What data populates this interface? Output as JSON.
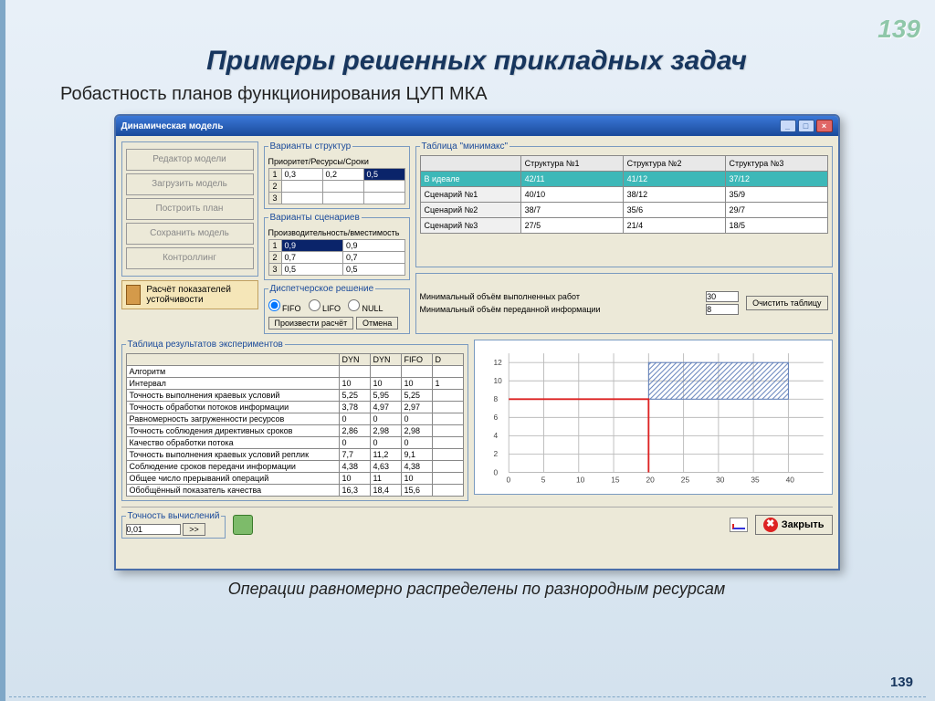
{
  "slide": {
    "title": "Примеры решенных прикладных задач",
    "subtitle": "Робастность планов функционирования ЦУП МКА",
    "bottom_caption": "Операции равномерно распределены по разнородным ресурсам",
    "page_number": "139",
    "corner_number": "139"
  },
  "window": {
    "title": "Динамическая модель",
    "side_buttons": [
      "Редактор модели",
      "Загрузить модель",
      "Построить план",
      "Сохранить модель",
      "Контроллинг"
    ],
    "calc_button": "Расчёт показателей устойчивости"
  },
  "variants_struct": {
    "legend": "Варианты структур",
    "header": "Приоритет/Ресурсы/Сроки",
    "rows": [
      {
        "n": "1",
        "a": "0,3",
        "b": "0,2",
        "c": "0,5",
        "sel": "c"
      },
      {
        "n": "2",
        "a": "",
        "b": "",
        "c": ""
      },
      {
        "n": "3",
        "a": "",
        "b": "",
        "c": ""
      }
    ]
  },
  "variants_scen": {
    "legend": "Варианты сценариев",
    "header": "Производительность/вместимость",
    "rows": [
      {
        "n": "1",
        "a": "0,9",
        "b": "0,9",
        "sel": "a"
      },
      {
        "n": "2",
        "a": "0,7",
        "b": "0,7"
      },
      {
        "n": "3",
        "a": "0,5",
        "b": "0,5"
      }
    ]
  },
  "dispatch": {
    "legend": "Диспетчерское решение",
    "options": [
      "FIFO",
      "LIFO",
      "NULL"
    ],
    "selected": "FIFO",
    "run": "Произвести расчёт",
    "cancel": "Отмена"
  },
  "minimax": {
    "legend": "Таблица \"минимакс\"",
    "cols": [
      "",
      "Структура №1",
      "Структура №2",
      "Структура №3"
    ],
    "rows": [
      {
        "name": "В идеале",
        "vals": [
          "42/11",
          "41/12",
          "37/12"
        ],
        "ideal": true
      },
      {
        "name": "Сценарий №1",
        "vals": [
          "40/10",
          "38/12",
          "35/9"
        ]
      },
      {
        "name": "Сценарий №2",
        "vals": [
          "38/7",
          "35/6",
          "29/7"
        ]
      },
      {
        "name": "Сценарий №3",
        "vals": [
          "27/5",
          "21/4",
          "18/5"
        ]
      }
    ]
  },
  "params": {
    "lbl1": "Минимальный объём выполненных работ",
    "val1": "30",
    "lbl2": "Минимальный объём переданной информации",
    "val2": "8",
    "clear": "Очистить таблицу"
  },
  "results": {
    "legend": "Таблица результатов экспериментов",
    "cols": [
      "",
      "DYN",
      "DYN",
      "FIFO",
      "D"
    ],
    "rows": [
      [
        "Алгоритм",
        "",
        "",
        "",
        ""
      ],
      [
        "Интервал",
        "10",
        "10",
        "10",
        "1"
      ],
      [
        "Точность выполнения краевых условий",
        "5,25",
        "5,95",
        "5,25",
        ""
      ],
      [
        "Точность обработки потоков информации",
        "3,78",
        "4,97",
        "2,97",
        ""
      ],
      [
        "Равномерность загруженности ресурсов",
        "0",
        "0",
        "0",
        ""
      ],
      [
        "Точность соблюдения директивных сроков",
        "2,86",
        "2,98",
        "2,98",
        ""
      ],
      [
        "Качество обработки потока",
        "0",
        "0",
        "0",
        ""
      ],
      [
        "Точность выполнения краевых условий реплик",
        "7,7",
        "11,2",
        "9,1",
        ""
      ],
      [
        "Соблюдение сроков передачи информации",
        "4,38",
        "4,63",
        "4,38",
        ""
      ],
      [
        "Общее число прерываний операций",
        "10",
        "11",
        "10",
        ""
      ],
      [
        "Обобщённый показатель качества",
        "16,3",
        "18,4",
        "15,6",
        ""
      ]
    ]
  },
  "footer": {
    "precision_label": "Точность вычислений",
    "precision_value": "0,01",
    "expand": ">>",
    "close": "Закрыть"
  },
  "chart_data": {
    "type": "line",
    "xlabel": "",
    "ylabel": "",
    "xlim": [
      0,
      45
    ],
    "ylim": [
      0,
      13
    ],
    "xticks": [
      0,
      5,
      10,
      15,
      20,
      25,
      30,
      35,
      40
    ],
    "yticks": [
      0,
      2,
      4,
      6,
      8,
      10,
      12
    ],
    "series": [
      {
        "name": "red-step",
        "type": "step",
        "points": [
          [
            0,
            8
          ],
          [
            20,
            8
          ],
          [
            20,
            0
          ]
        ]
      }
    ],
    "hatched_region": {
      "x0": 20,
      "y0": 8,
      "x1": 40,
      "y1": 12
    }
  }
}
